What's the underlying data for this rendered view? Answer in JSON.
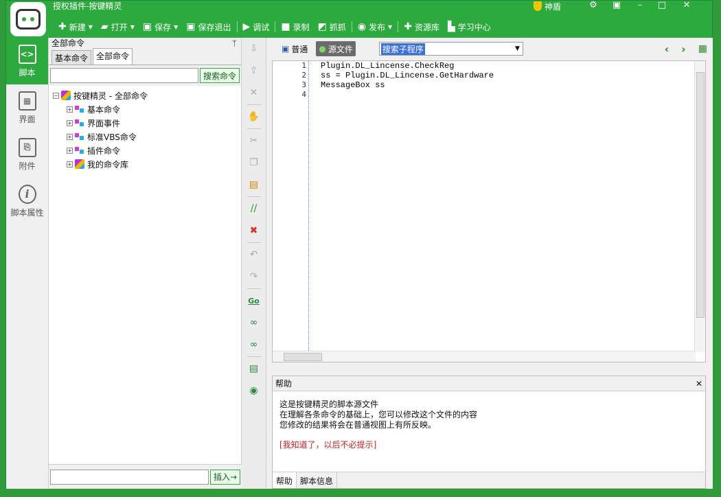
{
  "app": {
    "title": "授权插件-按键精灵",
    "shield_label": "神盾"
  },
  "toolbar": [
    {
      "icon": "plus-icon",
      "glyph": "✚",
      "label": "新建",
      "dropdown": true
    },
    {
      "icon": "folder-open-icon",
      "glyph": "▰",
      "label": "打开",
      "dropdown": true
    },
    {
      "icon": "save-icon",
      "glyph": "▣",
      "label": "保存",
      "dropdown": true
    },
    {
      "icon": "save-exit-icon",
      "glyph": "▣",
      "label": "保存退出",
      "dropdown": false
    },
    {
      "icon": "debug-play-icon",
      "glyph": "▶",
      "label": "调试",
      "dropdown": false
    },
    {
      "icon": "record-icon",
      "glyph": "■",
      "label": "录制",
      "dropdown": false
    },
    {
      "icon": "capture-icon",
      "glyph": "◩",
      "label": "抓抓",
      "dropdown": false
    },
    {
      "icon": "publish-icon",
      "glyph": "◉",
      "label": "发布",
      "dropdown": true
    },
    {
      "icon": "resource-icon",
      "glyph": "✚",
      "label": "资源库",
      "dropdown": false
    },
    {
      "icon": "learn-icon",
      "glyph": "▙",
      "label": "学习中心",
      "dropdown": false
    }
  ],
  "nav": [
    {
      "label": "脚本",
      "glyph": "<>",
      "icon": "script-icon",
      "active": true
    },
    {
      "label": "界面",
      "glyph": "▦",
      "icon": "interface-icon",
      "active": false
    },
    {
      "label": "附件",
      "glyph": "⎘",
      "icon": "attachment-icon",
      "active": false
    },
    {
      "label": "脚本属性",
      "glyph": "i",
      "icon": "info-icon",
      "active": false
    }
  ],
  "left": {
    "header": "全部命令",
    "pin": "ᛘ",
    "tabs": [
      "基本命令",
      "全部命令"
    ],
    "search_button": "搜索命令",
    "tree_root": "按键精灵 - 全部命令",
    "tree_items": [
      "基本命令",
      "界面事件",
      "标准VBS命令",
      "插件命令",
      "我的命令库"
    ],
    "insert_button": "插入→"
  },
  "editor": {
    "view_normal": "普通",
    "view_source": "源文件",
    "search_sub": "搜索子程序",
    "line_numbers": [
      "1",
      "2",
      "3",
      "4"
    ],
    "lines": [
      "Plugin.DL_Lincense.CheckReg",
      "ss = Plugin.DL_Lincense.GetHardware",
      "MessageBox ss",
      ""
    ]
  },
  "help": {
    "title": "帮助",
    "lines": [
      "这是按键精灵的脚本源文件",
      "在理解各条命令的基础上，您可以修改这个文件的内容",
      "您修改的结果将会在普通视图上有所反映。"
    ],
    "link": "[我知道了，以后不必提示]",
    "tabs": [
      "帮助",
      "脚本信息"
    ]
  }
}
